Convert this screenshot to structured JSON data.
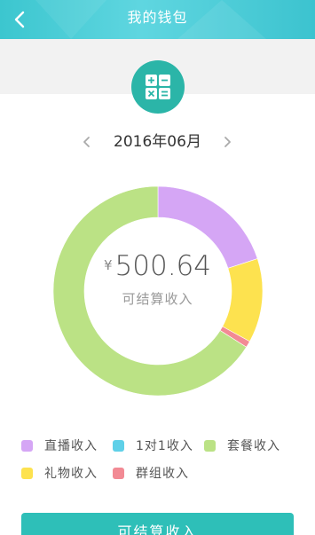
{
  "header": {
    "title": "我的钱包",
    "back_icon": "chevron-left-icon"
  },
  "wallet_icon": "calculator-icon",
  "month_selector": {
    "label": "2016年06月",
    "prev_icon": "chevron-left-icon",
    "next_icon": "chevron-right-icon"
  },
  "balance": {
    "currency": "¥",
    "amount": "500.64",
    "label": "可结算收入"
  },
  "chart_data": {
    "type": "pie",
    "variant": "donut",
    "start_at": "top-center",
    "direction": "clockwise",
    "slices": [
      {
        "label": "直播收入",
        "value": 20,
        "color": "#d5a6f5"
      },
      {
        "label": "1对1收入",
        "value": 0,
        "color": "#5fd0e8"
      },
      {
        "label": "礼物收入",
        "value": 13,
        "color": "#fde24f"
      },
      {
        "label": "群组收入",
        "value": 1,
        "color": "#f28a94"
      },
      {
        "label": "套餐收入",
        "value": 66,
        "color": "#bbe285"
      }
    ]
  },
  "legend": [
    {
      "label": "直播收入",
      "color": "#d5a6f5"
    },
    {
      "label": "1对1收入",
      "color": "#5fd0e8"
    },
    {
      "label": "套餐收入",
      "color": "#bbe285"
    },
    {
      "label": "礼物收入",
      "color": "#fde24f"
    },
    {
      "label": "群组收入",
      "color": "#f28a94"
    }
  ],
  "bottom_button": {
    "label": "可结算收入"
  }
}
